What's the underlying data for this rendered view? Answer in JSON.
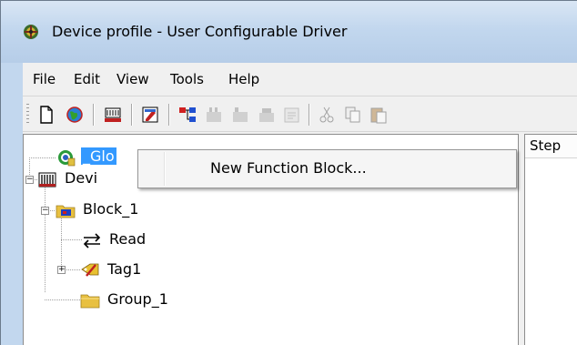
{
  "window": {
    "title": "Device profile - User Configurable Driver",
    "app_icon": "config-gear-icon"
  },
  "menubar": {
    "items": [
      "File",
      "Edit",
      "View",
      "Tools",
      "Help"
    ]
  },
  "toolbar": {
    "buttons": [
      {
        "icon": "new-document-icon",
        "enabled": true
      },
      {
        "icon": "globe-icon",
        "enabled": true
      },
      {
        "icon": "device-icon",
        "enabled": true
      },
      {
        "icon": "edit-properties-icon",
        "enabled": true
      },
      {
        "icon": "tree-structure-icon",
        "enabled": true
      },
      {
        "icon": "block-icon",
        "enabled": false
      },
      {
        "icon": "block-icon-2",
        "enabled": false
      },
      {
        "icon": "block-icon-3",
        "enabled": false
      },
      {
        "icon": "properties-icon",
        "enabled": false
      },
      {
        "icon": "cut-icon",
        "enabled": false
      },
      {
        "icon": "copy-icon",
        "enabled": false
      },
      {
        "icon": "paste-icon",
        "enabled": false
      }
    ]
  },
  "tree": {
    "nodes": [
      {
        "label": "_Glo",
        "icon": "globe-node-icon",
        "selected": true
      },
      {
        "label": "Devi",
        "icon": "device-node-icon",
        "expander": "−"
      },
      {
        "label": "Block_1",
        "icon": "block-folder-icon",
        "expander": "−"
      },
      {
        "label": "Read",
        "icon": "read-arrows-icon"
      },
      {
        "label": "Tag1",
        "icon": "tag-icon",
        "expander": "+"
      },
      {
        "label": "Group_1",
        "icon": "group-folder-icon"
      }
    ]
  },
  "right_panel": {
    "column_header": "Step"
  },
  "context_menu": {
    "items": [
      "New Function Block..."
    ]
  }
}
